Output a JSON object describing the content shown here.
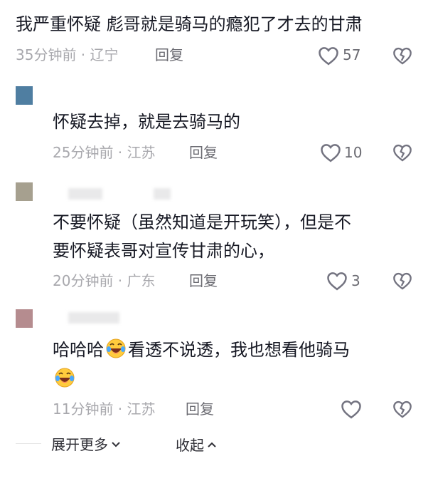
{
  "comments": [
    {
      "text": "我严重怀疑  彪哥就是骑马的瘾犯了才去的甘肃",
      "meta": "35分钟前 · 辽宁",
      "reply": "回复",
      "likes": "57"
    },
    {
      "text": "怀疑去掉，就是去骑马的",
      "meta": "25分钟前 · 江苏",
      "reply": "回复",
      "likes": "10"
    },
    {
      "text_line1": "不要怀疑（虽然知道是开玩笑），但是不",
      "text_line2": "要怀疑表哥对宣传甘肃的心，",
      "meta": "20分钟前 · 广东",
      "reply": "回复",
      "likes": "3"
    },
    {
      "text_a": "哈哈哈",
      "text_b": "看透不说透，我也想看他骑马",
      "meta": "11分钟前 · 江苏",
      "reply": "回复",
      "likes": ""
    }
  ],
  "footer": {
    "expand": "展开更多",
    "collapse": "收起"
  },
  "colors": {
    "avatar1": "#4f7ea1",
    "avatar2": "#a6a08f",
    "avatar3": "#b58c8f"
  }
}
